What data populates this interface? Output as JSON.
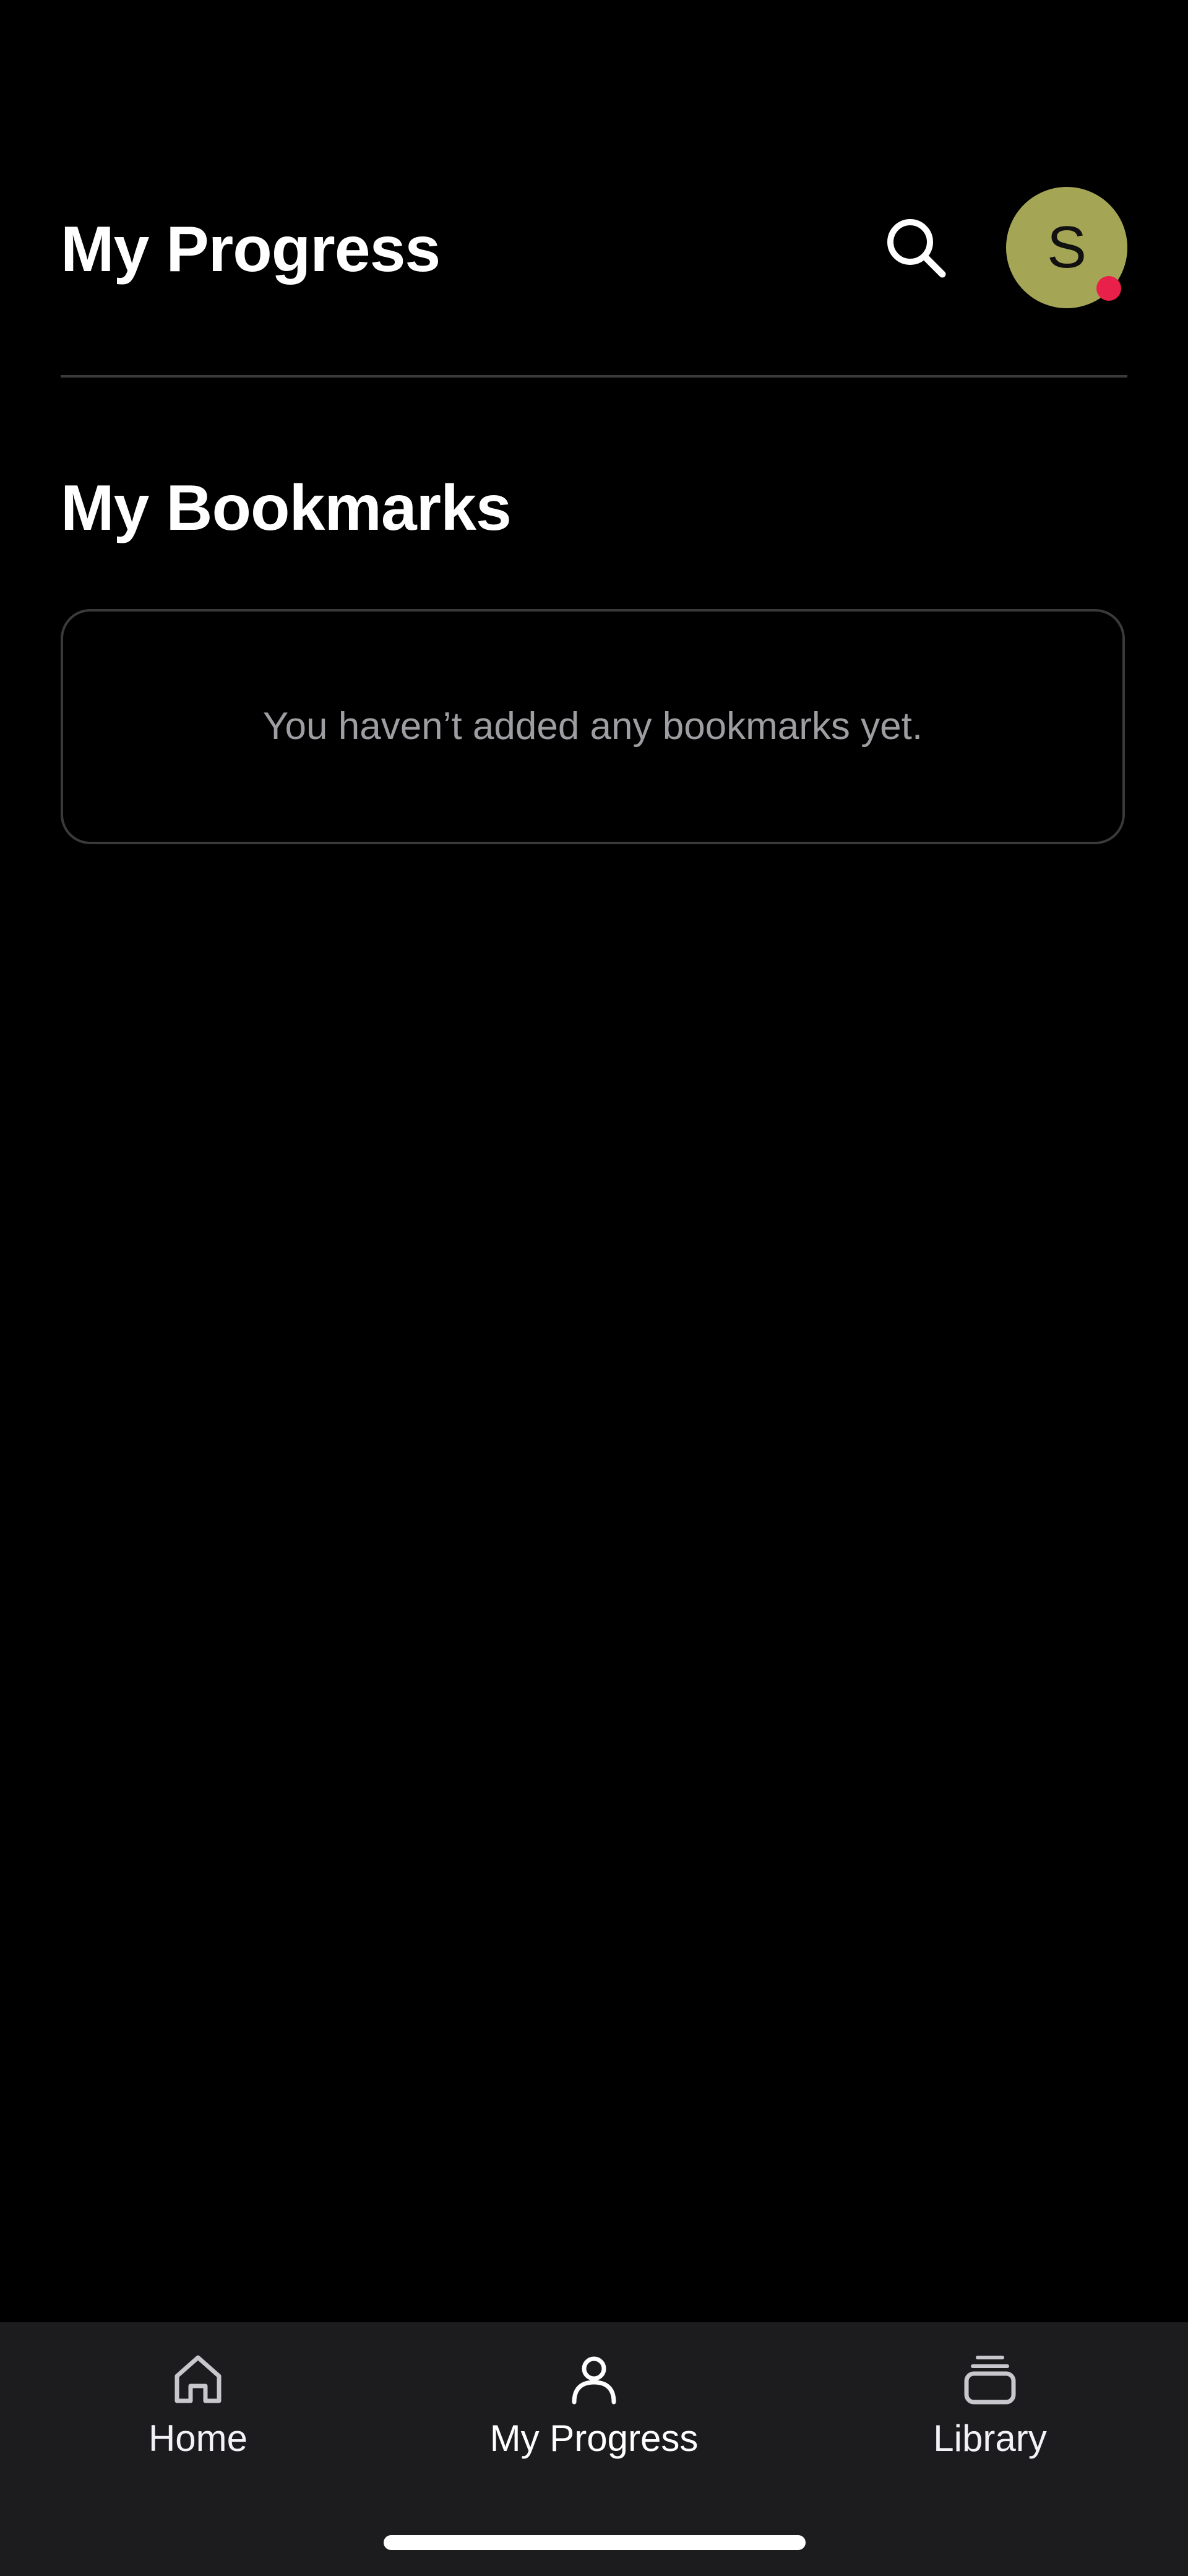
{
  "header": {
    "title": "My Progress",
    "search_icon": "search-icon",
    "avatar_initial": "S",
    "avatar_color": "#a5a655",
    "notification_color": "#e8204a"
  },
  "bookmarks": {
    "title": "My Bookmarks",
    "empty_message": "You haven’t added any bookmarks yet."
  },
  "tab_bar": {
    "items": [
      {
        "label": "Home",
        "icon": "home-icon",
        "active": false
      },
      {
        "label": "My Progress",
        "icon": "person-icon",
        "active": true
      },
      {
        "label": "Library",
        "icon": "library-stack-icon",
        "active": false
      }
    ]
  },
  "colors": {
    "background": "#000000",
    "tab_bar_background": "#1c1c1e",
    "divider": "#3a3a3c",
    "muted_text": "#9d9da2"
  }
}
